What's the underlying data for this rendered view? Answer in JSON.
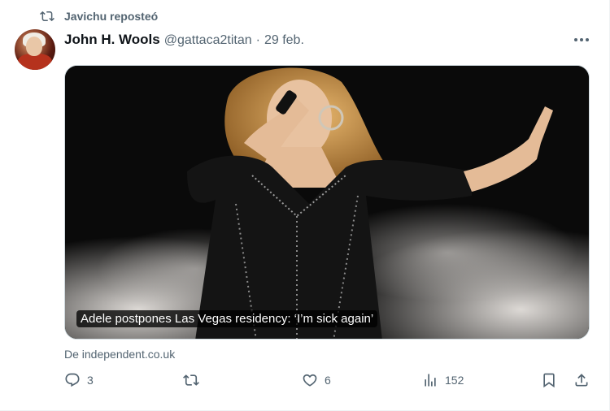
{
  "repost": {
    "label": "Javichu reposteó",
    "icon": "repost-icon"
  },
  "author": {
    "name": "John H. Wools",
    "handle": "@gattaca2titan",
    "separator": "·",
    "date": "29 feb."
  },
  "card": {
    "title": "Adele postpones Las Vegas residency: ‘I’m sick again’",
    "source": "De independent.co.uk"
  },
  "actions": {
    "replies": "3",
    "reposts": "",
    "likes": "6",
    "views": "152"
  },
  "colors": {
    "muted": "#536471",
    "text": "#0f1419",
    "border": "#cfd9de"
  }
}
